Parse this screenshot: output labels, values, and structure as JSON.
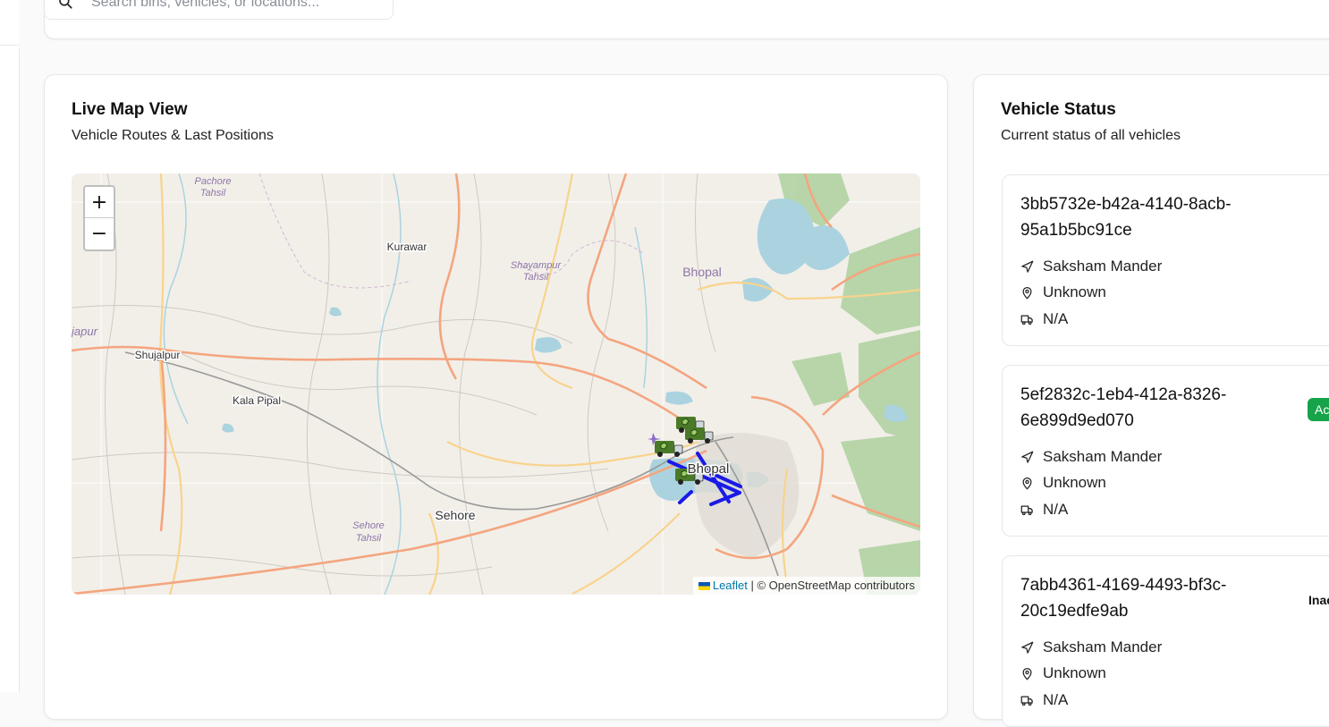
{
  "search": {
    "placeholder": "Search bins, vehicles, or locations..."
  },
  "map_card": {
    "title": "Live Map View",
    "subtitle": "Vehicle Routes & Last Positions",
    "zoom_in": "+",
    "zoom_out": "−",
    "attribution": {
      "leaflet": "Leaflet",
      "rest": " | © OpenStreetMap contributors"
    },
    "labels": {
      "pachore": [
        "Pachore",
        "Tahsil"
      ],
      "kurawar": "Kurawar",
      "shyampur": [
        "Shayampur",
        "Tahsil"
      ],
      "bhopal_top": "Bhopal",
      "japur": "japur",
      "shujalpur": "Shujalpur",
      "kala_pipal": "Kala Pipal",
      "bhopal_city": "Bhopal",
      "sehore": "Sehore",
      "sehore_tahsil": [
        "Sehore",
        "Tahsil"
      ]
    }
  },
  "status_card": {
    "title": "Vehicle Status",
    "subtitle": "Current status of all vehicles",
    "vehicles": [
      {
        "id_line1": "3bb5732e-b42a-4140-8acb-",
        "id_line2": "95a1b5bc91ce",
        "driver": "Saksham Mander",
        "location": "Unknown",
        "vehicle": "N/A",
        "badge": ""
      },
      {
        "id_line1": "5ef2832c-1eb4-412a-8326-",
        "id_line2": "6e899d9ed070",
        "driver": "Saksham Mander",
        "location": "Unknown",
        "vehicle": "N/A",
        "badge": "Ac"
      },
      {
        "id_line1": "7abb4361-4169-4493-bf3c-",
        "id_line2": "20c19edfe9ab",
        "driver": "Saksham Mander",
        "location": "Unknown",
        "vehicle": "N/A",
        "badge": "Inac"
      }
    ]
  },
  "colors": {
    "map_bg": "#f2efe9",
    "water": "#aad3df",
    "forest": "#add19e",
    "major_road": "#f4a57f",
    "secondary_road": "#f8d38d",
    "route": "#1a1ae6",
    "active_badge": "#16a34a"
  }
}
